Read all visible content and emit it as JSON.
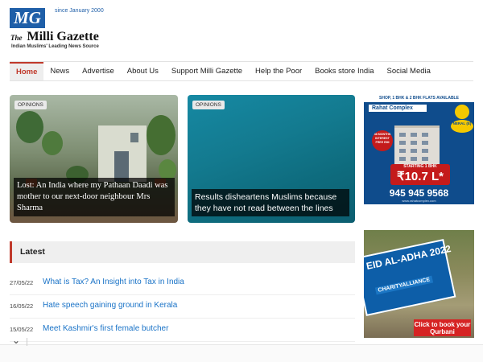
{
  "header": {
    "logo_text": "MG",
    "since": "since January 2000",
    "brand_prefix": "The",
    "brand_name": "Milli Gazette",
    "tagline": "Indian Muslims' Leading News Source"
  },
  "nav": {
    "items": [
      {
        "label": "Home",
        "active": true
      },
      {
        "label": "News"
      },
      {
        "label": "Advertise"
      },
      {
        "label": "About Us"
      },
      {
        "label": "Support Milli Gazette"
      },
      {
        "label": "Help the Poor"
      },
      {
        "label": "Books store India"
      },
      {
        "label": "Social Media"
      }
    ]
  },
  "features": [
    {
      "badge": "OPINIONS",
      "title": "Lost: An India where my Pathaan Daadi was mother to our next-door neighbour Mrs Sharma"
    },
    {
      "badge": "OPINIONS",
      "title": "Results disheartens Muslims because they have not read between the lines"
    }
  ],
  "ads": {
    "rahat": {
      "strip": "SHOP, 1 BHK & 2 BHK FLATS AVAILABLE",
      "name": "Rahat Complex",
      "neral": "NERAL (E)",
      "emi": "48 MONTHS INTEREST FREE EMI",
      "starting": "STARTING 1 BHK",
      "price": "₹10.7 L*",
      "phone": "945 945 9568",
      "site": "www.rahatcomplex.com"
    },
    "qurbani": {
      "eid": "EID AL-ADHA 2022",
      "charity": "CHARITYALLIANCE",
      "cta": "Click to book your Qurbani"
    }
  },
  "latest": {
    "heading": "Latest",
    "items": [
      {
        "date": "27/05/22",
        "title": "What is Tax? An Insight into Tax in India"
      },
      {
        "date": "16/05/22",
        "title": "Hate speech gaining ground in Kerala"
      },
      {
        "date": "15/05/22",
        "title": "Meet Kashmir's first female butcher"
      }
    ]
  },
  "colors": {
    "accent_red": "#c0392b",
    "brand_blue": "#1f5fa8",
    "link_blue": "#1a73c7"
  }
}
